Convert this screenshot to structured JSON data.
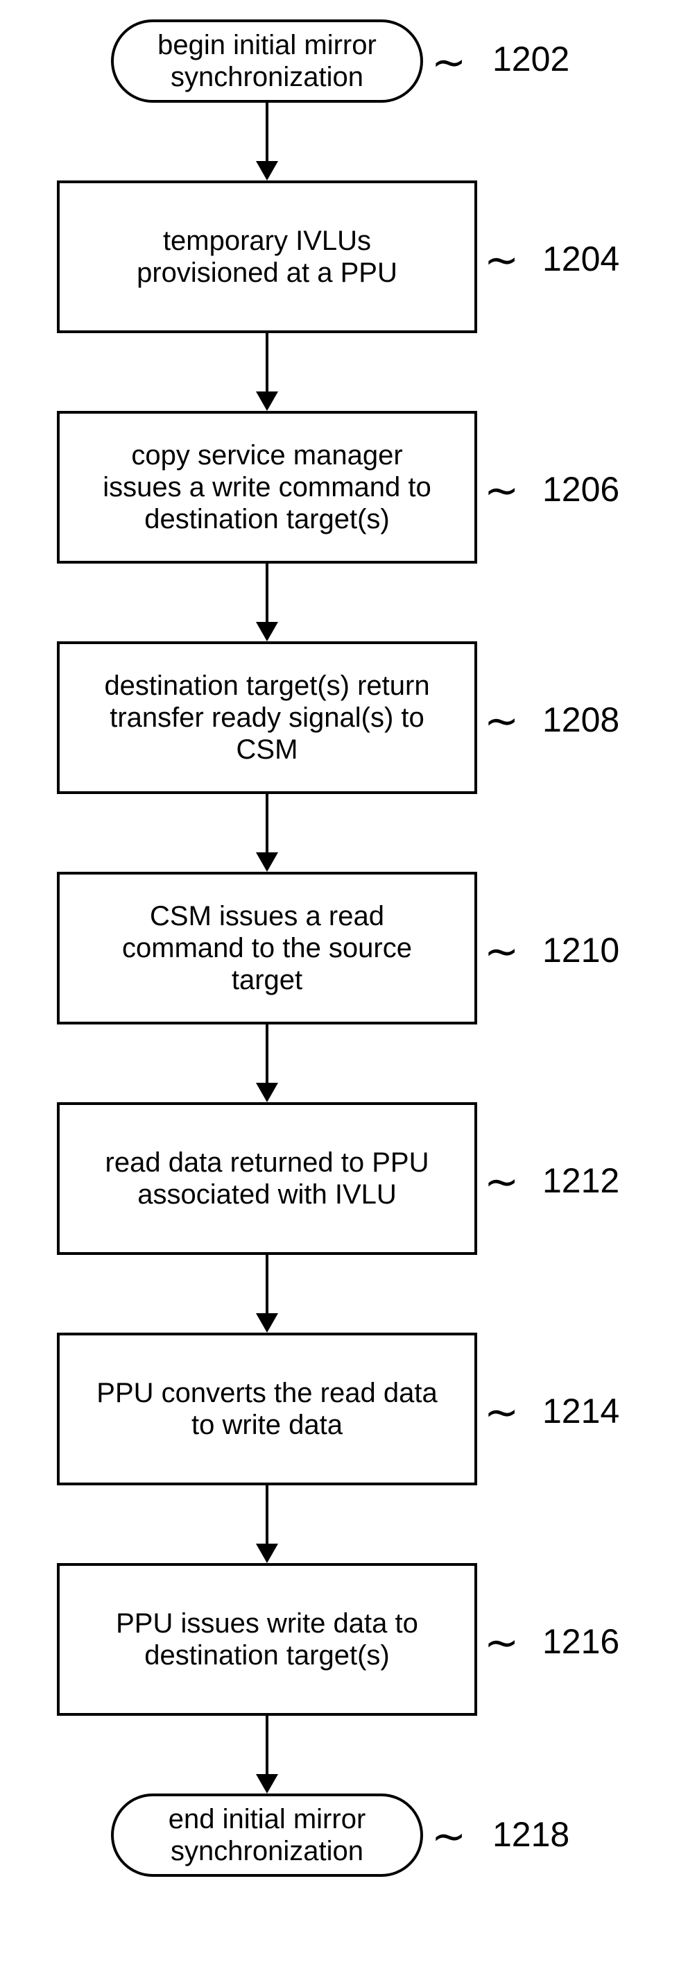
{
  "chart_data": {
    "type": "flowchart",
    "title": "",
    "nodes": [
      {
        "id": "1202",
        "type": "terminator",
        "text": "begin initial mirror synchronization"
      },
      {
        "id": "1204",
        "type": "process",
        "text": "temporary IVLUs provisioned at a PPU"
      },
      {
        "id": "1206",
        "type": "process",
        "text": "copy service manager issues a write command to destination target(s)"
      },
      {
        "id": "1208",
        "type": "process",
        "text": "destination target(s) return transfer ready signal(s) to CSM"
      },
      {
        "id": "1210",
        "type": "process",
        "text": "CSM issues a read command to the source target"
      },
      {
        "id": "1212",
        "type": "process",
        "text": "read data returned to PPU associated with IVLU"
      },
      {
        "id": "1214",
        "type": "process",
        "text": "PPU converts the read data to write data"
      },
      {
        "id": "1216",
        "type": "process",
        "text": "PPU issues write data to destination target(s)"
      },
      {
        "id": "1218",
        "type": "terminator",
        "text": "end initial mirror synchronization"
      }
    ],
    "edges": [
      [
        "1202",
        "1204"
      ],
      [
        "1204",
        "1206"
      ],
      [
        "1206",
        "1208"
      ],
      [
        "1208",
        "1210"
      ],
      [
        "1210",
        "1212"
      ],
      [
        "1212",
        "1214"
      ],
      [
        "1214",
        "1216"
      ],
      [
        "1216",
        "1218"
      ]
    ]
  },
  "nodes": {
    "n1202": {
      "text": "begin initial mirror\nsynchronization",
      "label": "1202"
    },
    "n1204": {
      "text": "temporary IVLUs\nprovisioned at a PPU",
      "label": "1204"
    },
    "n1206": {
      "text": "copy service manager\nissues a write command to\ndestination target(s)",
      "label": "1206"
    },
    "n1208": {
      "text": "destination target(s) return\ntransfer ready signal(s) to\nCSM",
      "label": "1208"
    },
    "n1210": {
      "text": "CSM issues a read\ncommand to the source\ntarget",
      "label": "1210"
    },
    "n1212": {
      "text": "read data returned to PPU\nassociated with IVLU",
      "label": "1212"
    },
    "n1214": {
      "text": "PPU converts the read data\nto write data",
      "label": "1214"
    },
    "n1216": {
      "text": "PPU issues write data to\ndestination target(s)",
      "label": "1216"
    },
    "n1218": {
      "text": "end initial mirror\nsynchronization",
      "label": "1218"
    }
  }
}
